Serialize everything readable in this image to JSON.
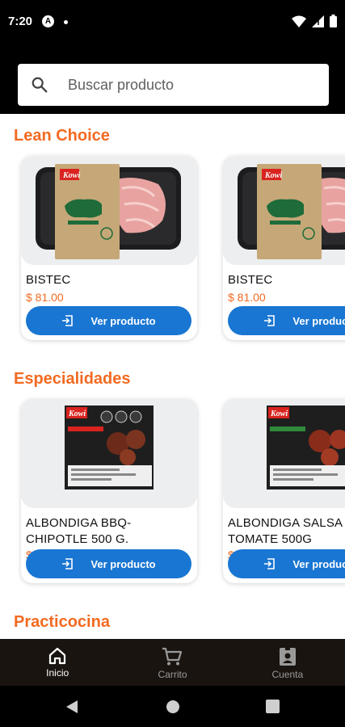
{
  "status_bar": {
    "time": "7:20",
    "notification_letter": "A"
  },
  "search": {
    "placeholder": "Buscar producto"
  },
  "sections": [
    {
      "title": "Lean Choice",
      "products": [
        {
          "name": "BISTEC",
          "price": "$ 81.00",
          "button": "Ver producto",
          "brand": "Kowi"
        },
        {
          "name": "BISTEC",
          "price": "$ 81.00",
          "button": "Ver producto",
          "brand": "Kowi"
        }
      ]
    },
    {
      "title": "Especialidades",
      "products": [
        {
          "name": "ALBONDIGA BBQ-CHIPOTLE 500 G.",
          "price": "$ 62.50",
          "button": "Ver producto",
          "brand": "Kowi"
        },
        {
          "name": "ALBONDIGA SALSA TOMATE 500G",
          "price": "$ 62.50",
          "button": "Ver producto",
          "brand": "Kowi"
        }
      ]
    },
    {
      "title": "Practicocina",
      "products": []
    }
  ],
  "bottom_nav": [
    {
      "label": "Inicio",
      "icon": "home-icon",
      "active": true
    },
    {
      "label": "Carrito",
      "icon": "cart-icon",
      "active": false
    },
    {
      "label": "Cuenta",
      "icon": "account-icon",
      "active": false
    }
  ],
  "colors": {
    "accent": "#f26a21",
    "button": "#1976d2",
    "header": "#000000"
  }
}
